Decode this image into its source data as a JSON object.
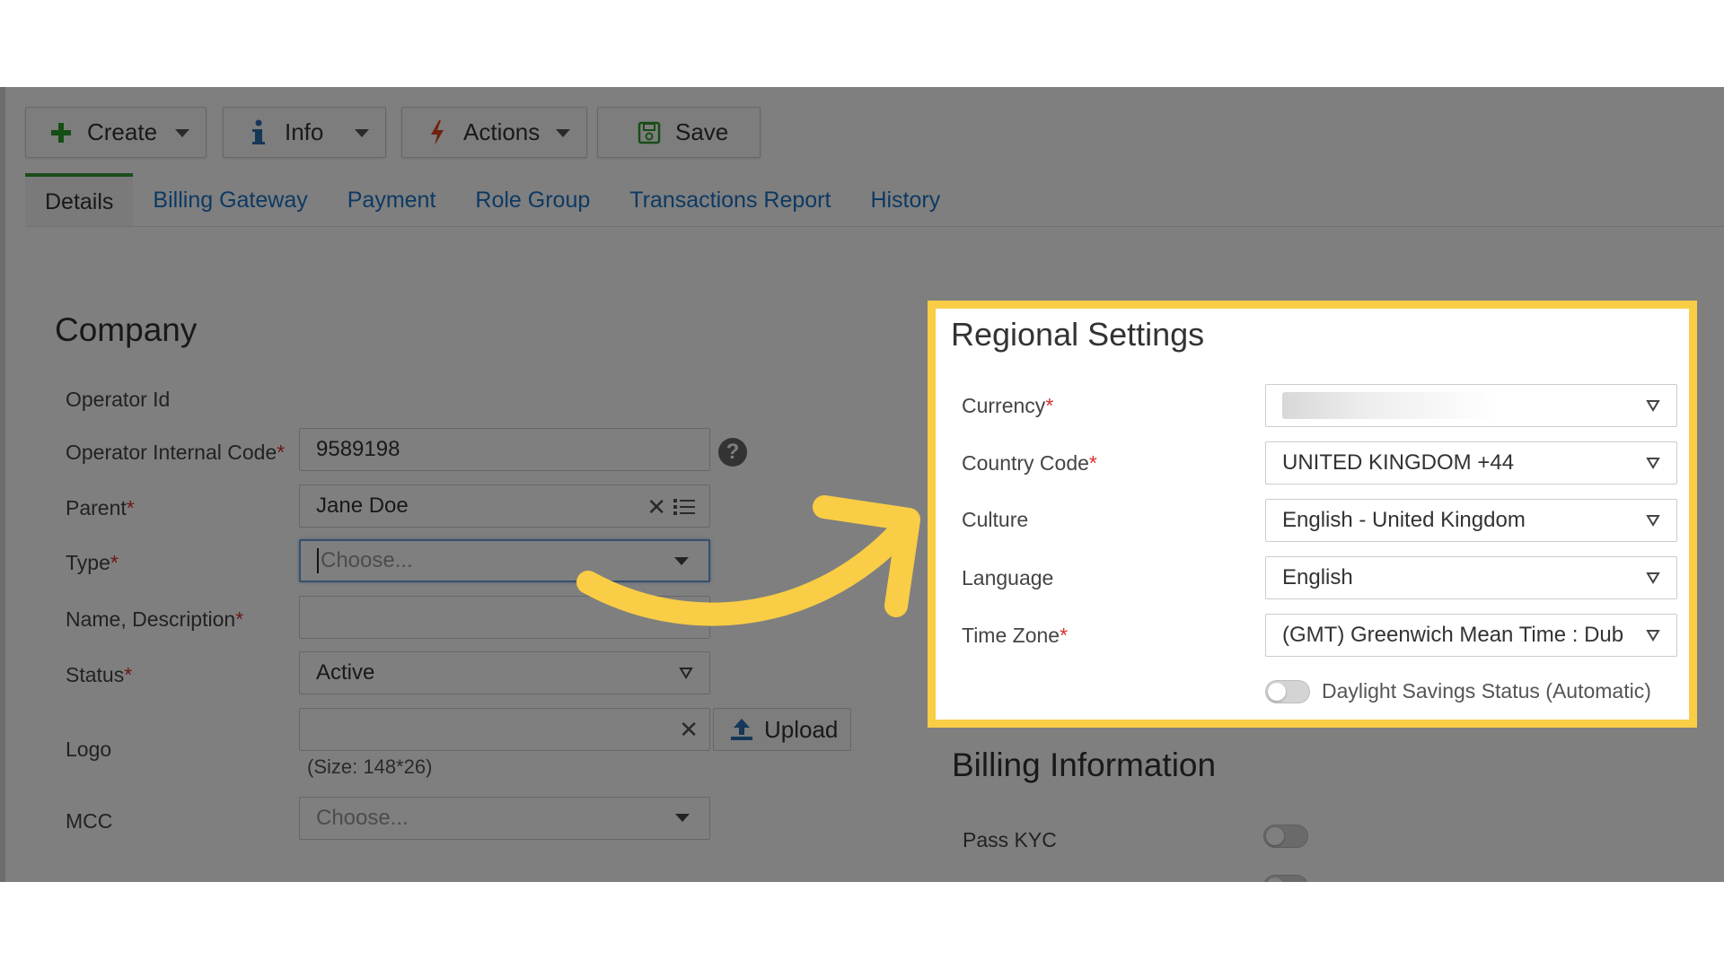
{
  "toolbar": {
    "create_label": "Create",
    "info_label": "Info",
    "actions_label": "Actions",
    "save_label": "Save"
  },
  "tabs": [
    {
      "label": "Details",
      "active": true
    },
    {
      "label": "Billing Gateway"
    },
    {
      "label": "Payment"
    },
    {
      "label": "Role Group"
    },
    {
      "label": "Transactions Report"
    },
    {
      "label": "History"
    }
  ],
  "company": {
    "title": "Company",
    "operator_id_label": "Operator Id",
    "internal_code_label": "Operator Internal Code",
    "internal_code_value": "9589198",
    "parent_label": "Parent",
    "parent_value": "Jane Doe",
    "type_label": "Type",
    "type_placeholder": "Choose...",
    "name_label": "Name, Description",
    "status_label": "Status",
    "status_value": "Active",
    "logo_label": "Logo",
    "upload_label": "Upload",
    "logo_hint": "(Size: 148*26)",
    "mcc_label": "MCC",
    "mcc_placeholder": "Choose..."
  },
  "regional": {
    "title": "Regional Settings",
    "currency_label": "Currency",
    "country_code_label": "Country Code",
    "country_code_value": "UNITED KINGDOM +44",
    "culture_label": "Culture",
    "culture_value": "English - United Kingdom",
    "language_label": "Language",
    "language_value": "English",
    "timezone_label": "Time Zone",
    "timezone_value": "(GMT) Greenwich Mean Time : Dub",
    "daylight_label": "Daylight Savings Status (Automatic)"
  },
  "billing": {
    "title": "Billing Information",
    "pass_kyc_label": "Pass KYC"
  },
  "colors": {
    "highlight": "#f9cd45",
    "tab_active_border": "#3a9a3a",
    "link": "#1a73c7",
    "required": "#d9302c"
  }
}
